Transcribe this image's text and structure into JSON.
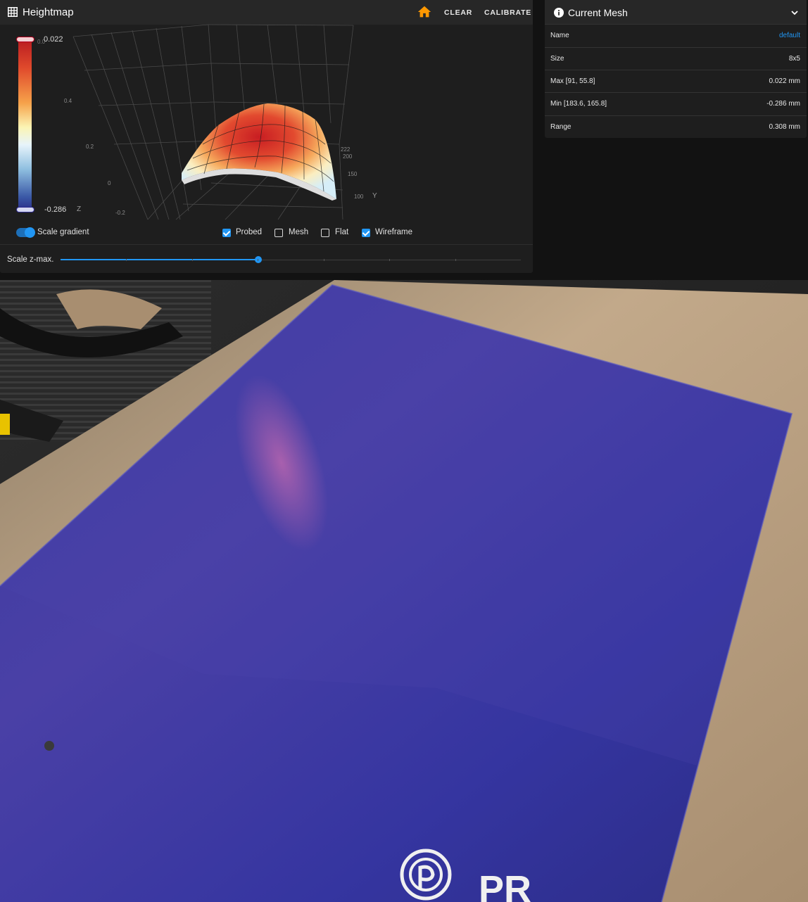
{
  "heightmap": {
    "title": "Heightmap",
    "clear_label": "CLEAR",
    "calibrate_label": "CALIBRATE",
    "gradient_max": "0.022",
    "gradient_min": "-0.286",
    "gradient_top_faint": "0.0",
    "z_ticks": [
      "0.4",
      "0.2",
      "0",
      "-0.2"
    ],
    "y_ticks": [
      "222",
      "200",
      "150",
      "100"
    ],
    "z_axis_name": "Z",
    "y_axis_name": "Y",
    "scale_gradient_label": "Scale gradient",
    "scale_gradient_on": true,
    "checkboxes": [
      {
        "label": "Probed",
        "checked": true
      },
      {
        "label": "Mesh",
        "checked": false
      },
      {
        "label": "Flat",
        "checked": false
      },
      {
        "label": "Wireframe",
        "checked": true
      }
    ],
    "scale_zmax_label": "Scale z-max.",
    "scale_zmax_fraction": 0.43
  },
  "current_mesh": {
    "title": "Current Mesh",
    "rows": [
      {
        "key": "Name",
        "value": "default",
        "is_link": true
      },
      {
        "key": "Size",
        "value": "8x5"
      },
      {
        "key": "Max [91, 55.8]",
        "value": "0.022 mm"
      },
      {
        "key": "Min [183.6, 165.8]",
        "value": "-0.286 mm"
      },
      {
        "key": "Range",
        "value": "0.308 mm"
      }
    ]
  },
  "photo": {
    "description_icon": "print-bed-photo",
    "logo_text": "PR"
  },
  "colors": {
    "accent": "#2196f3",
    "home_icon": "#ff9800",
    "card_bg": "#1e1e1e",
    "header_bg": "#272727"
  }
}
